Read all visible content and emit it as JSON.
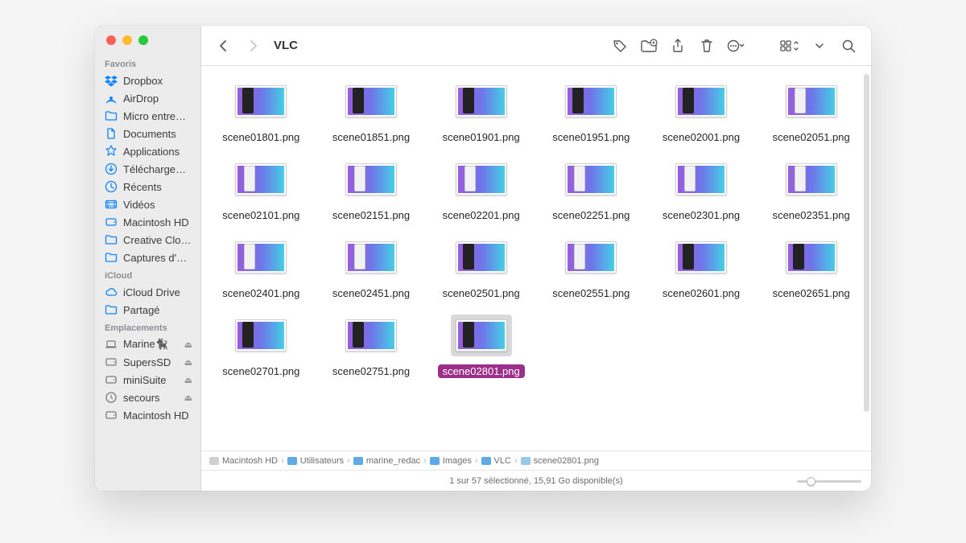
{
  "window": {
    "title": "VLC"
  },
  "sidebar": {
    "sections": [
      {
        "title": "Favoris",
        "items": [
          {
            "icon": "dropbox",
            "label": "Dropbox"
          },
          {
            "icon": "airdrop",
            "label": "AirDrop"
          },
          {
            "icon": "folder",
            "label": "Micro entre…"
          },
          {
            "icon": "doc",
            "label": "Documents"
          },
          {
            "icon": "apps",
            "label": "Applications"
          },
          {
            "icon": "download",
            "label": "Télécharge…"
          },
          {
            "icon": "clock",
            "label": "Récents"
          },
          {
            "icon": "video",
            "label": "Vidéos"
          },
          {
            "icon": "hdd",
            "label": "Macintosh HD"
          },
          {
            "icon": "folder",
            "label": "Creative Clo…"
          },
          {
            "icon": "folder",
            "label": "Captures d'…"
          }
        ]
      },
      {
        "title": "iCloud",
        "items": [
          {
            "icon": "cloud",
            "label": "iCloud Drive"
          },
          {
            "icon": "folder",
            "label": "Partagé"
          }
        ]
      },
      {
        "title": "Emplacements",
        "items": [
          {
            "icon": "laptop",
            "label": "Marine🐈‍⬛",
            "eject": true
          },
          {
            "icon": "hdd",
            "label": "SupersSD",
            "eject": true
          },
          {
            "icon": "hdd",
            "label": "miniSuite",
            "eject": true
          },
          {
            "icon": "disc",
            "label": "secours",
            "eject": true
          },
          {
            "icon": "hdd",
            "label": "Macintosh HD"
          }
        ]
      }
    ]
  },
  "files": [
    {
      "name": "scene01801.png",
      "phone": "dark",
      "pos": "left"
    },
    {
      "name": "scene01851.png",
      "phone": "dark",
      "pos": "left"
    },
    {
      "name": "scene01901.png",
      "phone": "dark",
      "pos": "left"
    },
    {
      "name": "scene01951.png",
      "phone": "dark",
      "pos": "left"
    },
    {
      "name": "scene02001.png",
      "phone": "dark",
      "pos": "left"
    },
    {
      "name": "scene02051.png",
      "phone": "light",
      "pos": "leftish"
    },
    {
      "name": "scene02101.png",
      "phone": "light",
      "pos": "leftish"
    },
    {
      "name": "scene02151.png",
      "phone": "light",
      "pos": "leftish"
    },
    {
      "name": "scene02201.png",
      "phone": "light",
      "pos": "leftish"
    },
    {
      "name": "scene02251.png",
      "phone": "light",
      "pos": "leftish"
    },
    {
      "name": "scene02301.png",
      "phone": "light",
      "pos": "leftish"
    },
    {
      "name": "scene02351.png",
      "phone": "light",
      "pos": "leftish"
    },
    {
      "name": "scene02401.png",
      "phone": "light",
      "pos": "leftish"
    },
    {
      "name": "scene02451.png",
      "phone": "light",
      "pos": "leftish"
    },
    {
      "name": "scene02501.png",
      "phone": "dark",
      "pos": "left"
    },
    {
      "name": "scene02551.png",
      "phone": "light",
      "pos": "leftish"
    },
    {
      "name": "scene02601.png",
      "phone": "dark",
      "pos": "left"
    },
    {
      "name": "scene02651.png",
      "phone": "dark",
      "pos": "left"
    },
    {
      "name": "scene02701.png",
      "phone": "dark",
      "pos": "left"
    },
    {
      "name": "scene02751.png",
      "phone": "dark",
      "pos": "left"
    },
    {
      "name": "scene02801.png",
      "phone": "dark",
      "pos": "left",
      "selected": true
    }
  ],
  "path": [
    {
      "icon": "disk",
      "label": "Macintosh HD"
    },
    {
      "icon": "folder",
      "label": "Utilisateurs"
    },
    {
      "icon": "folder",
      "label": "marine_redac"
    },
    {
      "icon": "folder",
      "label": "Images"
    },
    {
      "icon": "folder",
      "label": "VLC"
    },
    {
      "icon": "image",
      "label": "scene02801.png"
    }
  ],
  "status": "1 sur 57 sélectionné, 15,91 Go disponible(s)"
}
